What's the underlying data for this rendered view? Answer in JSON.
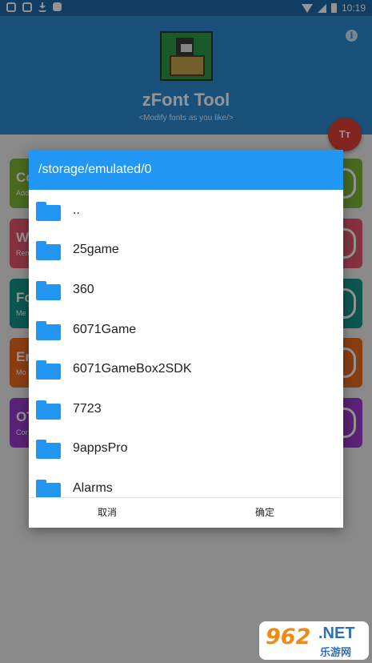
{
  "status_bar": {
    "time": "10:19",
    "left_icons": [
      "app-notification-icon",
      "app-notification-icon",
      "download-icon",
      "image-icon"
    ],
    "right_icons": [
      "wifi-icon",
      "signal-icon",
      "battery-icon"
    ]
  },
  "app": {
    "title": "zFont Tool",
    "subtitle": "<Modify fonts as you like/>",
    "info_icon_glyph": "i",
    "fab_label": "Tт",
    "header_color": "#2a8ad2",
    "cards": [
      {
        "title": "Co",
        "subtitle": "Add",
        "color": "#7fb53a",
        "icon": "smile-icon"
      },
      {
        "title": "W",
        "subtitle": "Ren",
        "color": "#e5556e",
        "icon": "eraser-icon"
      },
      {
        "title": "Fo",
        "subtitle": "Me",
        "color": "#15948a",
        "icon": "font-icon"
      },
      {
        "title": "Er",
        "subtitle": "Mo",
        "color": "#f06a1f",
        "icon": "emoji-icon"
      },
      {
        "title": "OT",
        "subtitle": "Cor",
        "color": "#9a3ccc",
        "icon": "play-icon"
      }
    ]
  },
  "dialog": {
    "path": "/storage/emulated/0",
    "header_color": "#2196f3",
    "items": [
      "..",
      "25game",
      "360",
      "6071Game",
      "6071GameBox2SDK",
      "7723",
      "9appsPro",
      "Alarms"
    ],
    "cancel_label": "取消",
    "ok_label": "确定"
  },
  "watermark": {
    "number": "962",
    "net": ".NET",
    "chinese": "乐游网"
  }
}
